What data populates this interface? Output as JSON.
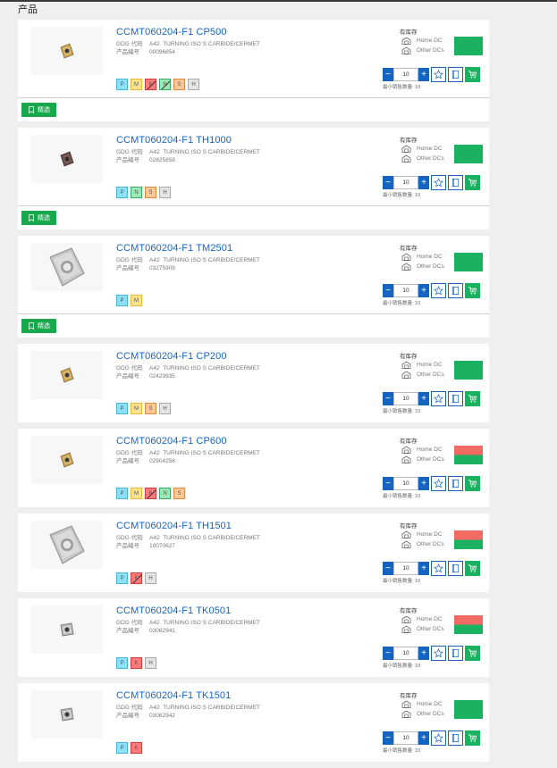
{
  "section": {
    "title": "产品"
  },
  "filter_label": "精选",
  "labels": {
    "gdg_code": "GDG 代码",
    "product_no": "产品编号",
    "stock": "有库存",
    "home_dc": "Home DC",
    "other_dcs": "Other DCs",
    "min_qty": "最小销售数量: 10"
  },
  "colors": {
    "link": "#1565c0",
    "available": "#1ab161",
    "unavailable": "#f26b63"
  },
  "products": [
    {
      "title": "CCMT060204-F1 CP500",
      "gdg_code": "A42",
      "gdg_desc": "TURNING ISO S CARBIDE/CERMET",
      "product_no": "00096854",
      "grades": [
        {
          "code": "P",
          "slash": false
        },
        {
          "code": "M",
          "slash": false
        },
        {
          "code": "K",
          "slash": true
        },
        {
          "code": "N",
          "slash": true
        },
        {
          "code": "S",
          "slash": false
        },
        {
          "code": "H",
          "slash": false
        }
      ],
      "qty": "10",
      "availability": "green",
      "image": "small-gold-insert",
      "filter": true
    },
    {
      "title": "CCMT060204-F1 TH1000",
      "gdg_code": "A42",
      "gdg_desc": "TURNING ISO S CARBIDE/CERMET",
      "product_no": "02825858",
      "grades": [
        {
          "code": "P",
          "slash": false
        },
        {
          "code": "N",
          "slash": false
        },
        {
          "code": "S",
          "slash": false
        },
        {
          "code": "H",
          "slash": false
        }
      ],
      "qty": "10",
      "availability": "green",
      "image": "small-dark-insert",
      "filter": true
    },
    {
      "title": "CCMT060204-F1 TM2501",
      "gdg_code": "A42",
      "gdg_desc": "TURNING ISO S CARBIDE/CERMET",
      "product_no": "03275909",
      "grades": [
        {
          "code": "P",
          "slash": false
        },
        {
          "code": "M",
          "slash": false
        }
      ],
      "qty": "10",
      "availability": "green",
      "image": "large-silver-insert",
      "filter": true
    },
    {
      "title": "CCMT060204-F1 CP200",
      "gdg_code": "A42",
      "gdg_desc": "TURNING ISO S CARBIDE/CERMET",
      "product_no": "02429935",
      "grades": [
        {
          "code": "P",
          "slash": false
        },
        {
          "code": "M",
          "slash": false
        },
        {
          "code": "S",
          "slash": false
        },
        {
          "code": "H",
          "slash": false
        }
      ],
      "qty": "10",
      "availability": "green",
      "image": "small-gold-insert",
      "filter": false
    },
    {
      "title": "CCMT060204-F1 CP600",
      "gdg_code": "A42",
      "gdg_desc": "TURNING ISO S CARBIDE/CERMET",
      "product_no": "02904256",
      "grades": [
        {
          "code": "P",
          "slash": false
        },
        {
          "code": "M",
          "slash": false
        },
        {
          "code": "K",
          "slash": true
        },
        {
          "code": "N",
          "slash": false
        },
        {
          "code": "S",
          "slash": false
        }
      ],
      "qty": "10",
      "availability": "split",
      "image": "small-gold-insert",
      "filter": false
    },
    {
      "title": "CCMT060204-F1 TH1501",
      "gdg_code": "A42",
      "gdg_desc": "TURNING ISO S CARBIDE/CERMET",
      "product_no": "10070627",
      "grades": [
        {
          "code": "P",
          "slash": false
        },
        {
          "code": "K",
          "slash": true
        },
        {
          "code": "H",
          "slash": false
        }
      ],
      "qty": "10",
      "availability": "split",
      "image": "large-silver-insert",
      "filter": false
    },
    {
      "title": "CCMT060204-F1 TK0501",
      "gdg_code": "A42",
      "gdg_desc": "TURNING ISO S CARBIDE/CERMET",
      "product_no": "03062941",
      "grades": [
        {
          "code": "P",
          "slash": false
        },
        {
          "code": "K",
          "slash": false
        },
        {
          "code": "H",
          "slash": false
        }
      ],
      "qty": "10",
      "availability": "split",
      "image": "small-silver-insert",
      "filter": false
    },
    {
      "title": "CCMT060204-F1 TK1501",
      "gdg_code": "A42",
      "gdg_desc": "TURNING ISO S CARBIDE/CERMET",
      "product_no": "03062942",
      "grades": [
        {
          "code": "P",
          "slash": false
        },
        {
          "code": "K",
          "slash": false
        }
      ],
      "qty": "10",
      "availability": "green",
      "image": "small-silver-insert",
      "filter": false
    }
  ]
}
